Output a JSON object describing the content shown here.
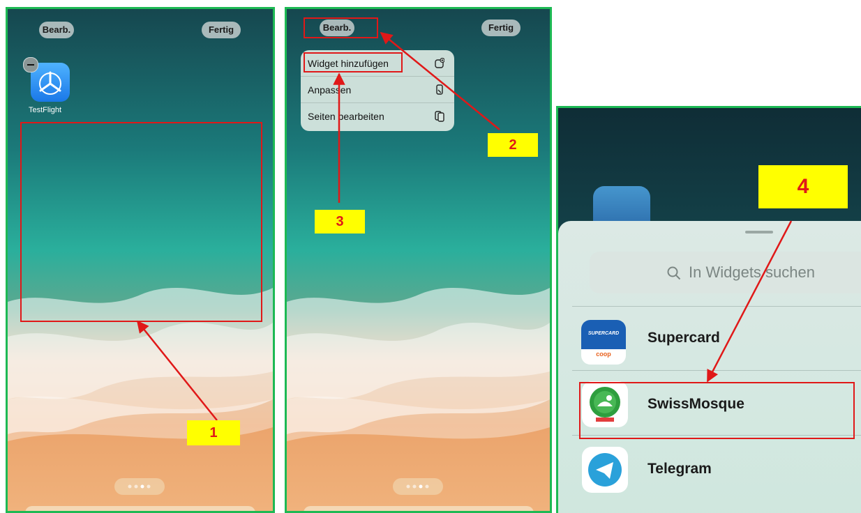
{
  "left_panel": {
    "edit_button": "Bearb.",
    "done_button": "Fertig",
    "app_label": "TestFlight",
    "step_label": "1"
  },
  "middle_panel": {
    "edit_button": "Bearb.",
    "done_button": "Fertig",
    "menu": [
      "Widget hinzufügen",
      "Anpassen",
      "Seiten bearbeiten"
    ],
    "step_label_2": "2",
    "step_label_3": "3"
  },
  "right_panel": {
    "search_placeholder": "In Widgets suchen",
    "apps": [
      "Supercard",
      "SwissMosque",
      "Telegram"
    ],
    "supercard_logo_top": "SUPERCARD",
    "supercard_logo_bottom": "coop",
    "step_label": "4"
  },
  "colors": {
    "panel_border": "#1db954",
    "annotation": "#e01818",
    "label_bg": "#ffff00"
  }
}
